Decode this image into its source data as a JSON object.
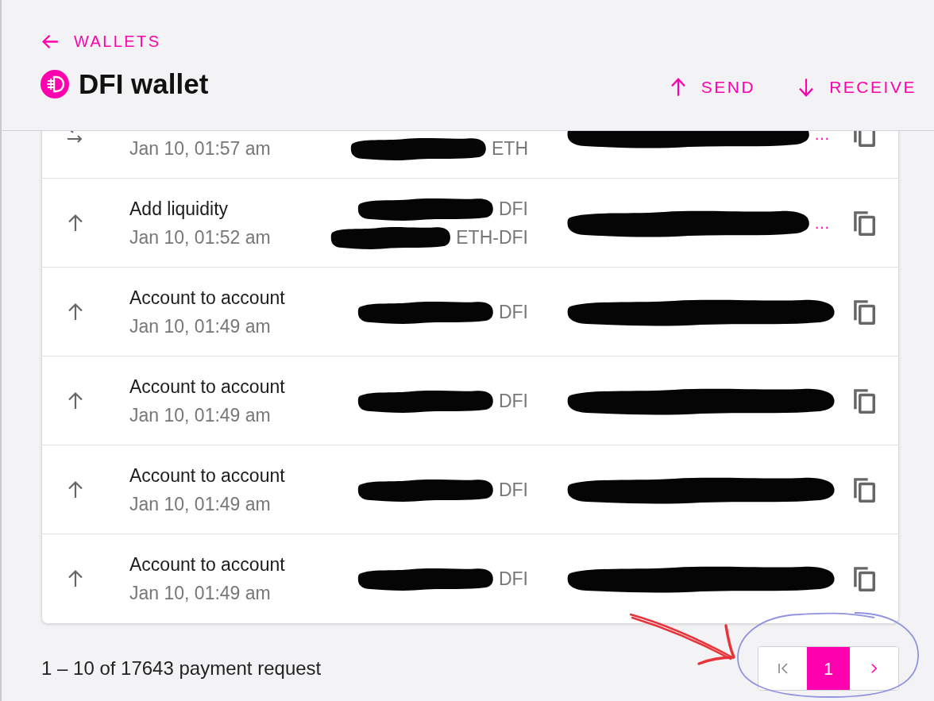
{
  "header": {
    "back_link": "WALLETS",
    "title": "DFI wallet",
    "actions": [
      {
        "label": "SEND",
        "kind": "send"
      },
      {
        "label": "RECEIVE",
        "kind": "receive"
      }
    ]
  },
  "transactions": [
    {
      "kind": "swap",
      "date": "Jan 10, 01:57 am",
      "amounts": [
        {
          "token": "ETH",
          "redacted": true
        }
      ],
      "address": {
        "redacted": true,
        "tail": "…"
      }
    },
    {
      "kind": "outgoing",
      "title": "Add liquidity",
      "date": "Jan 10, 01:52 am",
      "amounts": [
        {
          "token": "DFI",
          "redacted": true
        },
        {
          "token": "ETH-DFI",
          "redacted": true
        }
      ],
      "address": {
        "redacted": true,
        "tail": "…"
      }
    },
    {
      "kind": "outgoing",
      "title": "Account to account",
      "date": "Jan 10, 01:49 am",
      "amounts": [
        {
          "token": "DFI",
          "redacted": true
        }
      ],
      "address": {
        "redacted": true
      }
    },
    {
      "kind": "outgoing",
      "title": "Account to account",
      "date": "Jan 10, 01:49 am",
      "amounts": [
        {
          "token": "DFI",
          "redacted": true
        }
      ],
      "address": {
        "redacted": true
      }
    },
    {
      "kind": "outgoing",
      "title": "Account to account",
      "date": "Jan 10, 01:49 am",
      "amounts": [
        {
          "token": "DFI",
          "redacted": true
        }
      ],
      "address": {
        "redacted": true
      }
    },
    {
      "kind": "outgoing",
      "title": "Account to account",
      "date": "Jan 10, 01:49 am",
      "amounts": [
        {
          "token": "DFI",
          "redacted": true
        }
      ],
      "address": {
        "redacted": true
      }
    }
  ],
  "footer": {
    "range": "1 – 10 of 17643 payment request",
    "pagination": {
      "first_page": {
        "disabled": true
      },
      "pages": [
        {
          "label": "1",
          "selected": true
        }
      ],
      "next_page": {
        "disabled": false
      }
    }
  },
  "markup": {
    "arrow": true,
    "ellipse": true
  }
}
